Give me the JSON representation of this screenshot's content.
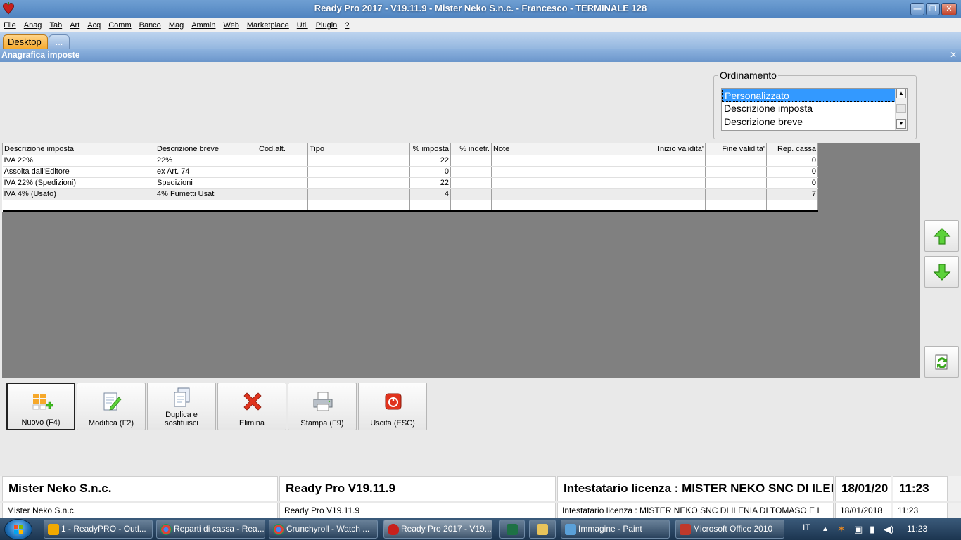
{
  "window": {
    "title": "Ready Pro 2017 - V19.11.9 - Mister Neko S.n.c. - Francesco - TERMINALE 128",
    "minimize": "—",
    "maximize": "❐",
    "close": "✕"
  },
  "menu": [
    "File",
    "Anag",
    "Tab",
    "Art",
    "Acq",
    "Comm",
    "Banco",
    "Mag",
    "Ammin",
    "Web",
    "Marketplace",
    "Util",
    "Plugin",
    "?"
  ],
  "tabs": {
    "active": "Desktop",
    "more": "..."
  },
  "form": {
    "title": "Anagrafica imposte",
    "close": "✕"
  },
  "ordinamento": {
    "label": "Ordinamento",
    "options": [
      "Personalizzato",
      "Descrizione imposta",
      "Descrizione breve"
    ],
    "selected_index": 0
  },
  "grid": {
    "columns": [
      "Descrizione imposta",
      "Descrizione breve",
      "Cod.alt.",
      "Tipo",
      "% imposta",
      "% indetr.",
      "Note",
      "Inizio validita'",
      "Fine validita'",
      "Rep. cassa"
    ],
    "rows": [
      [
        "IVA 22%",
        "22%",
        "",
        "",
        "22",
        "",
        "",
        "",
        "",
        "0"
      ],
      [
        "Assolta dall'Editore",
        "ex Art. 74",
        "",
        "",
        "0",
        "",
        "",
        "",
        "",
        "0"
      ],
      [
        "IVA 22% (Spedizioni)",
        "Spedizioni",
        "",
        "",
        "22",
        "",
        "",
        "",
        "",
        "0"
      ],
      [
        "IVA 4% (Usato)",
        "4% Fumetti Usati",
        "",
        "",
        "4",
        "",
        "",
        "",
        "",
        "7"
      ],
      [
        "",
        "",
        "",
        "",
        "",
        "",
        "",
        "",
        "",
        ""
      ]
    ]
  },
  "toolbar": {
    "nuovo": "Nuovo (F4)",
    "modifica": "Modifica (F2)",
    "duplica_1": "Duplica e",
    "duplica_2": "sostituisci",
    "elimina": "Elimina",
    "stampa": "Stampa (F9)",
    "uscita": "Uscita (ESC)"
  },
  "status": {
    "company": "Mister Neko S.n.c.",
    "version": "Ready Pro V19.11.9",
    "license_short": "Intestatario licenza : MISTER NEKO SNC DI ILEI",
    "license_full": "Intestatario licenza : MISTER NEKO SNC DI ILENIA DI TOMASO E I",
    "date_short": "18/01/20",
    "date": "18/01/2018",
    "time": "11:23"
  },
  "taskbar": {
    "items": [
      "1 - ReadyPRO - Outl...",
      "Reparti di cassa - Rea...",
      "Crunchyroll - Watch ...",
      "Ready Pro 2017 - V19...",
      "Immagine - Paint",
      "Microsoft Office 2010"
    ],
    "lang": "IT",
    "clock": "11:23"
  },
  "colors": {
    "accent_blue": "#3399ff",
    "tab_orange": "#f6a82a",
    "grid_bg": "#808080",
    "arrow_green": "#3fbf1f",
    "delete_red": "#e0331d"
  }
}
